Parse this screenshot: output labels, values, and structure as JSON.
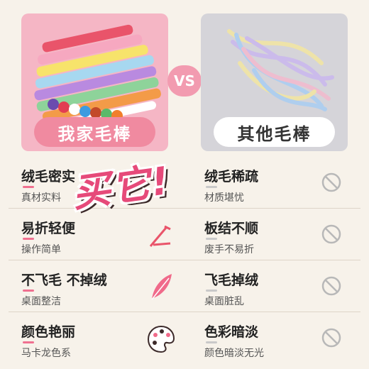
{
  "comparison": {
    "left_label": "我家毛棒",
    "right_label": "其他毛棒",
    "vs_label": "VS"
  },
  "stamp": {
    "text": "买它!"
  },
  "rows": [
    {
      "left_title": "绒毛密实",
      "left_sub": "真材实料",
      "right_title": "绒毛稀疏",
      "right_sub": "材质堪忧"
    },
    {
      "left_title": "易折轻便",
      "left_sub": "操作简单",
      "right_title": "板结不顺",
      "right_sub": "废手不易折"
    },
    {
      "left_title": "不飞毛 不掉绒",
      "left_sub": "桌面整洁",
      "right_title": "飞毛掉绒",
      "right_sub": "桌面脏乱"
    },
    {
      "left_title": "颜色艳丽",
      "left_sub": "马卡龙色系",
      "right_title": "色彩暗淡",
      "right_sub": "颜色暗淡无光"
    }
  ],
  "colors": {
    "accent_pink": "#f08aa0",
    "stamp_pink": "#e64a7a",
    "background": "#f7f2ea"
  },
  "icons": [
    "pipe-cleaner-icon",
    "feather-icon",
    "palette-icon",
    "prohibited-icon"
  ]
}
